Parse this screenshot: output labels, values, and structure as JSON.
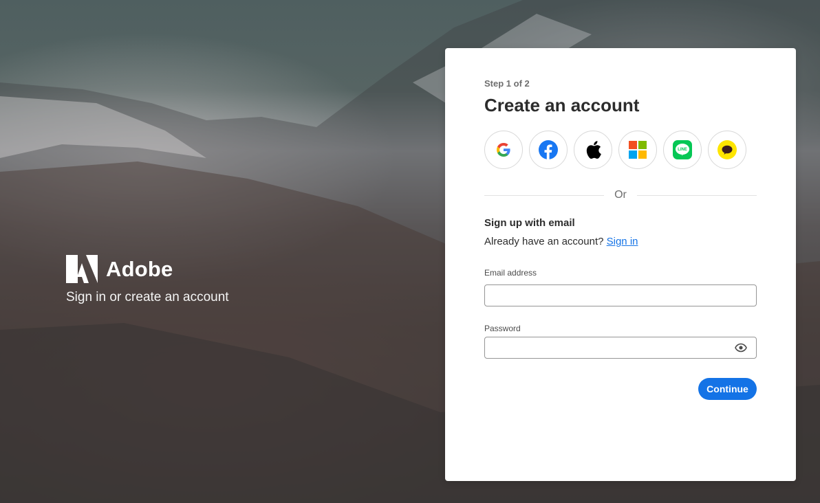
{
  "brand": {
    "name": "Adobe",
    "tagline": "Sign in or create an account"
  },
  "form": {
    "step": "Step 1 of 2",
    "title": "Create an account",
    "social_providers": [
      "google",
      "facebook",
      "apple",
      "microsoft",
      "line",
      "kakaotalk"
    ],
    "divider_text": "Or",
    "signup_heading": "Sign up with email",
    "already_text": "Already have an account?",
    "signin_link": "Sign in",
    "email_label": "Email address",
    "email_value": "",
    "password_label": "Password",
    "password_value": "",
    "continue_label": "Continue"
  },
  "colors": {
    "accent": "#1473e6",
    "facebook": "#1877f2",
    "line": "#06c755",
    "kakao": "#fee500"
  }
}
